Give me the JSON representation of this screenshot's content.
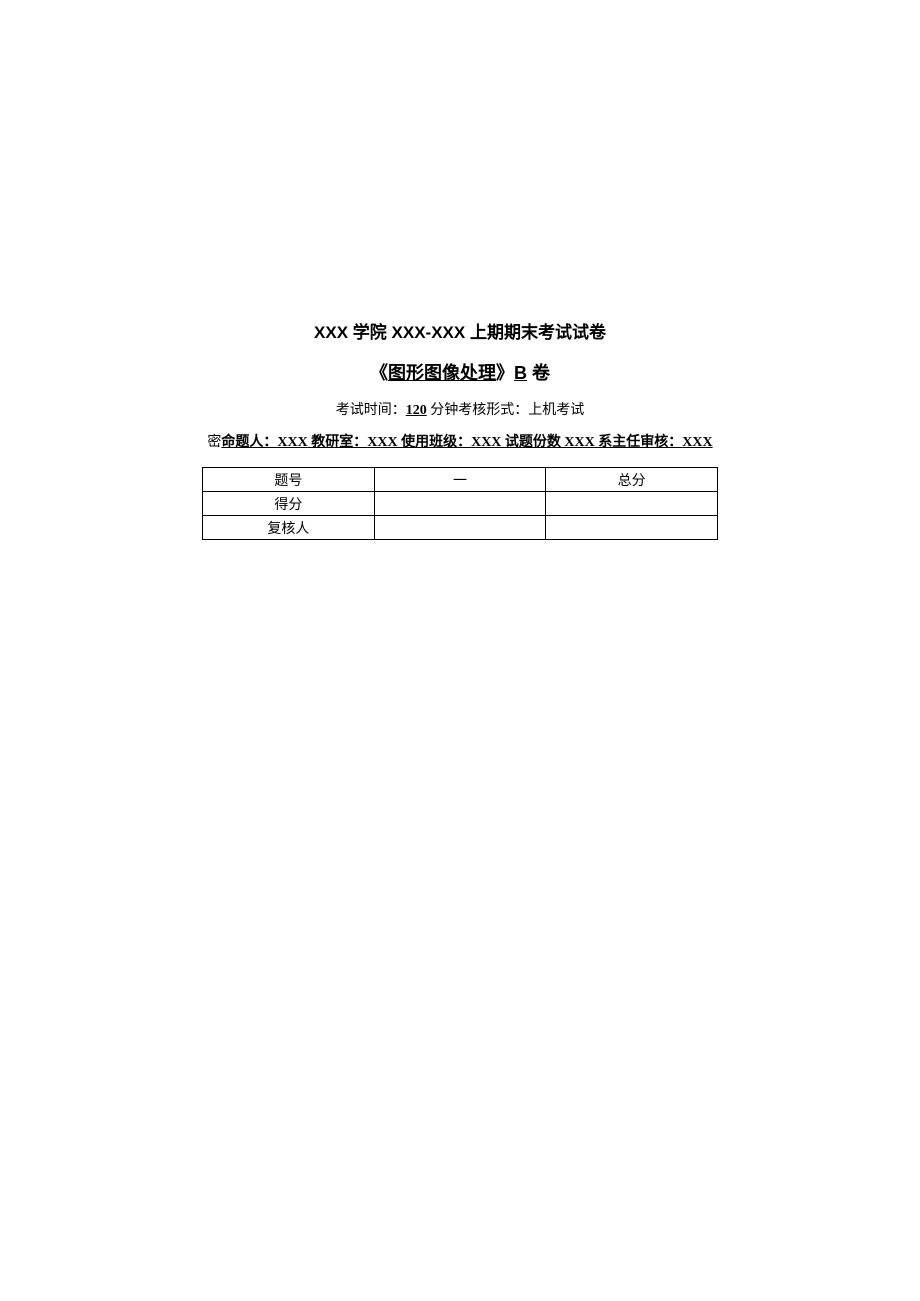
{
  "header": {
    "title_prefix": "XXX",
    "title_middle": " 学院 ",
    "title_code": "XXX-XXX",
    "title_suffix": " 上期期末考试试卷"
  },
  "subtitle": {
    "open_bracket": "《",
    "course_name": "图形图像处理",
    "close_bracket": "》",
    "paper_code": "B",
    "paper_suffix": " 卷"
  },
  "exam_info": {
    "time_label": "考试时间：",
    "time_value": "120",
    "time_unit": " 分钟",
    "format_label": "考核形式：",
    "format_value": "上机考试"
  },
  "meta": {
    "prefix": "密",
    "author_label": "命题人：",
    "author_value": "XXX",
    "dept_label": " 教研室：",
    "dept_value": "XXX",
    "class_label": " 使用班级：",
    "class_value": "XXX",
    "count_label": " 试题份数 ",
    "count_value": "XXX",
    "reviewer_label": " 系主任审核：",
    "reviewer_value": "XXX"
  },
  "table": {
    "rows": [
      {
        "c1": "题号",
        "c2": "一",
        "c3": "总分"
      },
      {
        "c1": "得分",
        "c2": "",
        "c3": ""
      },
      {
        "c1": "复核人",
        "c2": "",
        "c3": ""
      }
    ]
  }
}
